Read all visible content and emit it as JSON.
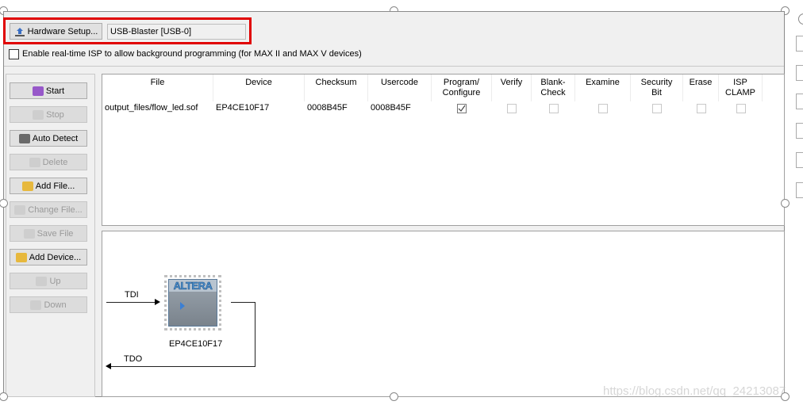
{
  "hardware": {
    "setup_label": "Hardware Setup...",
    "current": "USB-Blaster [USB-0]"
  },
  "isp": {
    "label": "Enable real-time ISP to allow background programming (for MAX II and MAX V devices)",
    "checked": false
  },
  "buttons": [
    {
      "label": "Start",
      "enabled": true
    },
    {
      "label": "Stop",
      "enabled": false
    },
    {
      "label": "Auto Detect",
      "enabled": true
    },
    {
      "label": "Delete",
      "enabled": false
    },
    {
      "label": "Add File...",
      "enabled": true
    },
    {
      "label": "Change File...",
      "enabled": false
    },
    {
      "label": "Save File",
      "enabled": false
    },
    {
      "label": "Add Device...",
      "enabled": true
    },
    {
      "label": "Up",
      "enabled": false
    },
    {
      "label": "Down",
      "enabled": false
    }
  ],
  "table": {
    "columns": [
      "File",
      "Device",
      "Checksum",
      "Usercode",
      "Program/\nConfigure",
      "Verify",
      "Blank-\nCheck",
      "Examine",
      "Security\nBit",
      "Erase",
      "ISP\nCLAMP"
    ],
    "rows": [
      {
        "file": "output_files/flow_led.sof",
        "device": "EP4CE10F17",
        "checksum": "0008B45F",
        "usercode": "0008B45F",
        "program": true,
        "verify": false,
        "blank_check": false,
        "examine": false,
        "security_bit": false,
        "erase": false,
        "isp_clamp": false
      }
    ]
  },
  "chain": {
    "tdi": "TDI",
    "tdo": "TDO",
    "device": "EP4CE10F17",
    "logo": "ALTERA"
  },
  "highlight_color": "#e00000",
  "watermark": "https://blog.csdn.net/qq_24213087"
}
